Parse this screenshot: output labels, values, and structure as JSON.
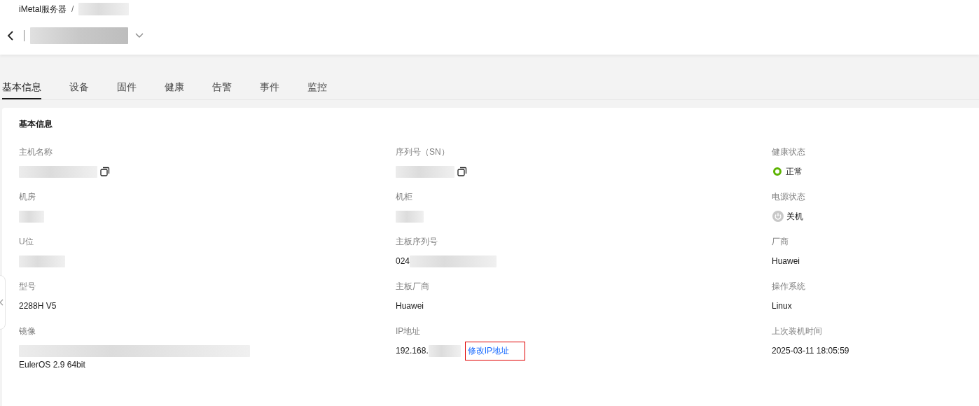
{
  "breadcrumb": {
    "items": [
      {
        "kind": "text",
        "text": "iMetal服务器"
      },
      {
        "kind": "redacted"
      }
    ],
    "separator": "/"
  },
  "tabs": [
    {
      "label": "基本信息",
      "selected": true
    },
    {
      "label": "设备",
      "selected": false
    },
    {
      "label": "固件",
      "selected": false
    },
    {
      "label": "健康",
      "selected": false
    },
    {
      "label": "告警",
      "selected": false
    },
    {
      "label": "事件",
      "selected": false
    },
    {
      "label": "监控",
      "selected": false
    }
  ],
  "section": {
    "title": "基本信息",
    "fields": [
      {
        "label": "主机名称",
        "copyable": true,
        "lines": [
          [
            {
              "kind": "redacted"
            }
          ]
        ]
      },
      {
        "label": "序列号（SN）",
        "copyable": true,
        "lines": [
          [
            {
              "kind": "redacted"
            }
          ]
        ]
      },
      {
        "label": "健康状态",
        "lines": [
          [
            {
              "kind": "healthy",
              "text": "正常"
            }
          ]
        ]
      },
      {
        "label": "机房",
        "lines": [
          [
            {
              "kind": "redacted"
            }
          ]
        ]
      },
      {
        "label": "机柜",
        "lines": [
          [
            {
              "kind": "redacted"
            }
          ]
        ]
      },
      {
        "label": "电源状态",
        "lines": [
          [
            {
              "kind": "poweroff",
              "text": "关机"
            }
          ]
        ]
      },
      {
        "label": "U位",
        "lines": [
          [
            {
              "kind": "redacted"
            }
          ]
        ]
      },
      {
        "label": "主板序列号",
        "lines": [
          [
            {
              "kind": "text",
              "text": "024"
            },
            {
              "kind": "redacted"
            }
          ]
        ]
      },
      {
        "label": "厂商",
        "lines": [
          [
            {
              "kind": "text",
              "text": "Huawei"
            }
          ]
        ]
      },
      {
        "label": "型号",
        "lines": [
          [
            {
              "kind": "text",
              "text": "2288H V5"
            }
          ]
        ]
      },
      {
        "label": "主板厂商",
        "lines": [
          [
            {
              "kind": "text",
              "text": "Huawei"
            }
          ]
        ]
      },
      {
        "label": "操作系统",
        "lines": [
          [
            {
              "kind": "text",
              "text": "Linux"
            }
          ]
        ]
      },
      {
        "label": "镜像",
        "lines": [
          [
            {
              "kind": "redacted"
            }
          ],
          [
            {
              "kind": "text",
              "text": "EulerOS 2.9 64bit"
            }
          ]
        ]
      },
      {
        "label": "IP地址",
        "lines": [
          [
            {
              "kind": "text",
              "text": "192.168."
            },
            {
              "kind": "redacted"
            },
            {
              "kind": "link",
              "text": "修改IP地址",
              "highlighted": true
            }
          ]
        ]
      },
      {
        "label": "上次装机时间",
        "lines": [
          [
            {
              "kind": "text",
              "text": "2025-03-11 18:05:59"
            }
          ]
        ]
      }
    ]
  }
}
